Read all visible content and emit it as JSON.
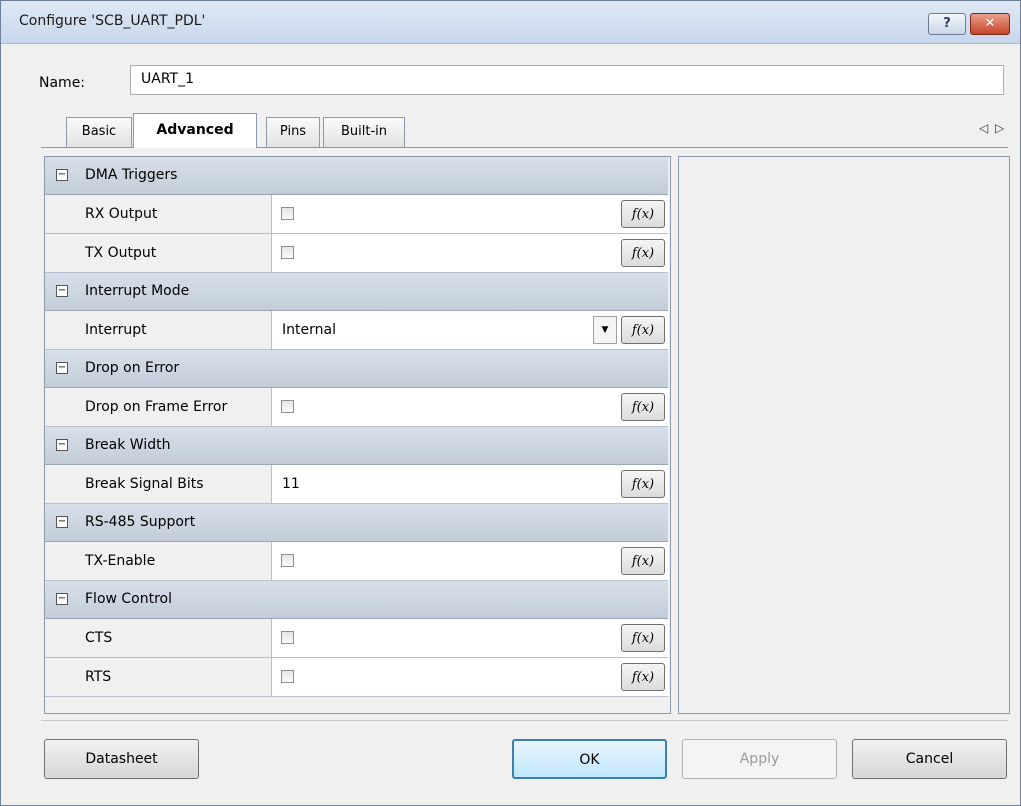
{
  "window": {
    "title": "Configure 'SCB_UART_PDL'",
    "help_label": "?",
    "close_label": "✕"
  },
  "name": {
    "label": "Name:",
    "value": "UART_1"
  },
  "tabs": [
    {
      "label": "Basic",
      "active": false
    },
    {
      "label": "Advanced",
      "active": true
    },
    {
      "label": "Pins",
      "active": false
    },
    {
      "label": "Built-in",
      "active": false
    }
  ],
  "tab_nav": {
    "prev": "◁",
    "next": "▷"
  },
  "sections": [
    {
      "title": "DMA Triggers",
      "toggle": "−",
      "rows": [
        {
          "label": "RX Output",
          "type": "checkbox",
          "checked": false,
          "fx": "f(x)"
        },
        {
          "label": "TX Output",
          "type": "checkbox",
          "checked": false,
          "fx": "f(x)"
        }
      ]
    },
    {
      "title": "Interrupt Mode",
      "toggle": "−",
      "rows": [
        {
          "label": "Interrupt",
          "type": "dropdown",
          "value": "Internal",
          "arrow": "▼",
          "fx": "f(x)"
        }
      ]
    },
    {
      "title": "Drop on Error",
      "toggle": "−",
      "rows": [
        {
          "label": "Drop on Frame Error",
          "type": "checkbox",
          "checked": false,
          "fx": "f(x)"
        }
      ]
    },
    {
      "title": "Break Width",
      "toggle": "−",
      "rows": [
        {
          "label": "Break Signal Bits",
          "type": "text",
          "value": "11",
          "fx": "f(x)"
        }
      ]
    },
    {
      "title": "RS-485 Support",
      "toggle": "−",
      "rows": [
        {
          "label": "TX-Enable",
          "type": "checkbox",
          "checked": false,
          "fx": "f(x)"
        }
      ]
    },
    {
      "title": "Flow Control",
      "toggle": "−",
      "rows": [
        {
          "label": "CTS",
          "type": "checkbox",
          "checked": false,
          "fx": "f(x)"
        },
        {
          "label": "RTS",
          "type": "checkbox",
          "checked": false,
          "fx": "f(x)"
        }
      ]
    }
  ],
  "buttons": {
    "datasheet": "Datasheet",
    "ok": "OK",
    "apply": "Apply",
    "cancel": "Cancel"
  },
  "colors": {
    "section_header": "#c9d3de",
    "ok_accent": "#3c7fb1",
    "close_button": "#c6452a"
  }
}
